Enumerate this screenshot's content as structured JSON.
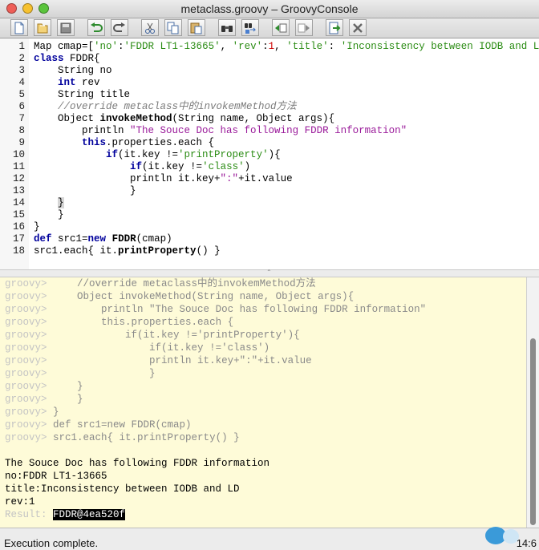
{
  "window": {
    "title": "metaclass.groovy – GroovyConsole"
  },
  "toolbar": {
    "buttons": [
      "new-file",
      "open-file",
      "save-file",
      "undo",
      "redo",
      "cut",
      "copy",
      "paste",
      "find",
      "replace",
      "history-previous",
      "history-next",
      "execute-script",
      "interrupt-script"
    ]
  },
  "editor": {
    "line_numbers": [
      "1",
      "2",
      "3",
      "4",
      "5",
      "6",
      "7",
      "8",
      "9",
      "10",
      "11",
      "12",
      "13",
      "14",
      "15",
      "16",
      "17",
      "18"
    ],
    "lines": [
      [
        "Map cmap=[",
        "'no'",
        ":",
        "'FDDR LT1-13665'",
        ", ",
        "'rev'",
        ":",
        "1",
        ", ",
        "'title'",
        ": ",
        "'Inconsistency between IODB and LD'",
        "]"
      ],
      [
        "class",
        " FDDR{"
      ],
      [
        "    String no"
      ],
      [
        "    ",
        "int",
        " rev"
      ],
      [
        "    String title"
      ],
      [
        "    //override metaclass中的invokemMethod方法"
      ],
      [
        "    Object ",
        "invokeMethod",
        "(String name, Object args){"
      ],
      [
        "        println ",
        "\"The Souce Doc has following FDDR information\""
      ],
      [
        "        ",
        "this",
        ".properties.each {"
      ],
      [
        "            ",
        "if",
        "(it.key !=",
        "'printProperty'",
        "){"
      ],
      [
        "                ",
        "if",
        "(it.key !=",
        "'class'",
        ")"
      ],
      [
        "                println it.key+",
        "\":\"",
        "+it.value"
      ],
      [
        "                }"
      ],
      [
        "    ",
        "}"
      ],
      [
        "    }"
      ],
      [
        "}"
      ],
      [
        "def",
        " src1=",
        "new",
        " ",
        "FDDR",
        "(cmap)"
      ],
      [
        "src1.each{ it.",
        "printProperty",
        "() }"
      ]
    ]
  },
  "console": {
    "prompt": "groovy>",
    "echo_lines": [
      "    //override metaclass中的invokemMethod方法",
      "    Object invokeMethod(String name, Object args){",
      "        println \"The Souce Doc has following FDDR information\"",
      "        this.properties.each {",
      "            if(it.key !='printProperty'){",
      "                if(it.key !='class')",
      "                println it.key+\":\"+it.value",
      "                }",
      "    }",
      "    }",
      "}",
      "def src1=new FDDR(cmap)",
      "src1.each{ it.printProperty() }"
    ],
    "output_lines": [
      "The Souce Doc has following FDDR information",
      "no:FDDR LT1-13665",
      "title:Inconsistency between IODB and LD",
      "rev:1"
    ],
    "result_label": "Result:",
    "result_value": "FDDR@4ea520f"
  },
  "status": {
    "message": "Execution complete.",
    "position": "14:6"
  },
  "colors": {
    "keyword": "#00009c",
    "string": "#2b8c14",
    "output_background": "#fefbd8"
  }
}
